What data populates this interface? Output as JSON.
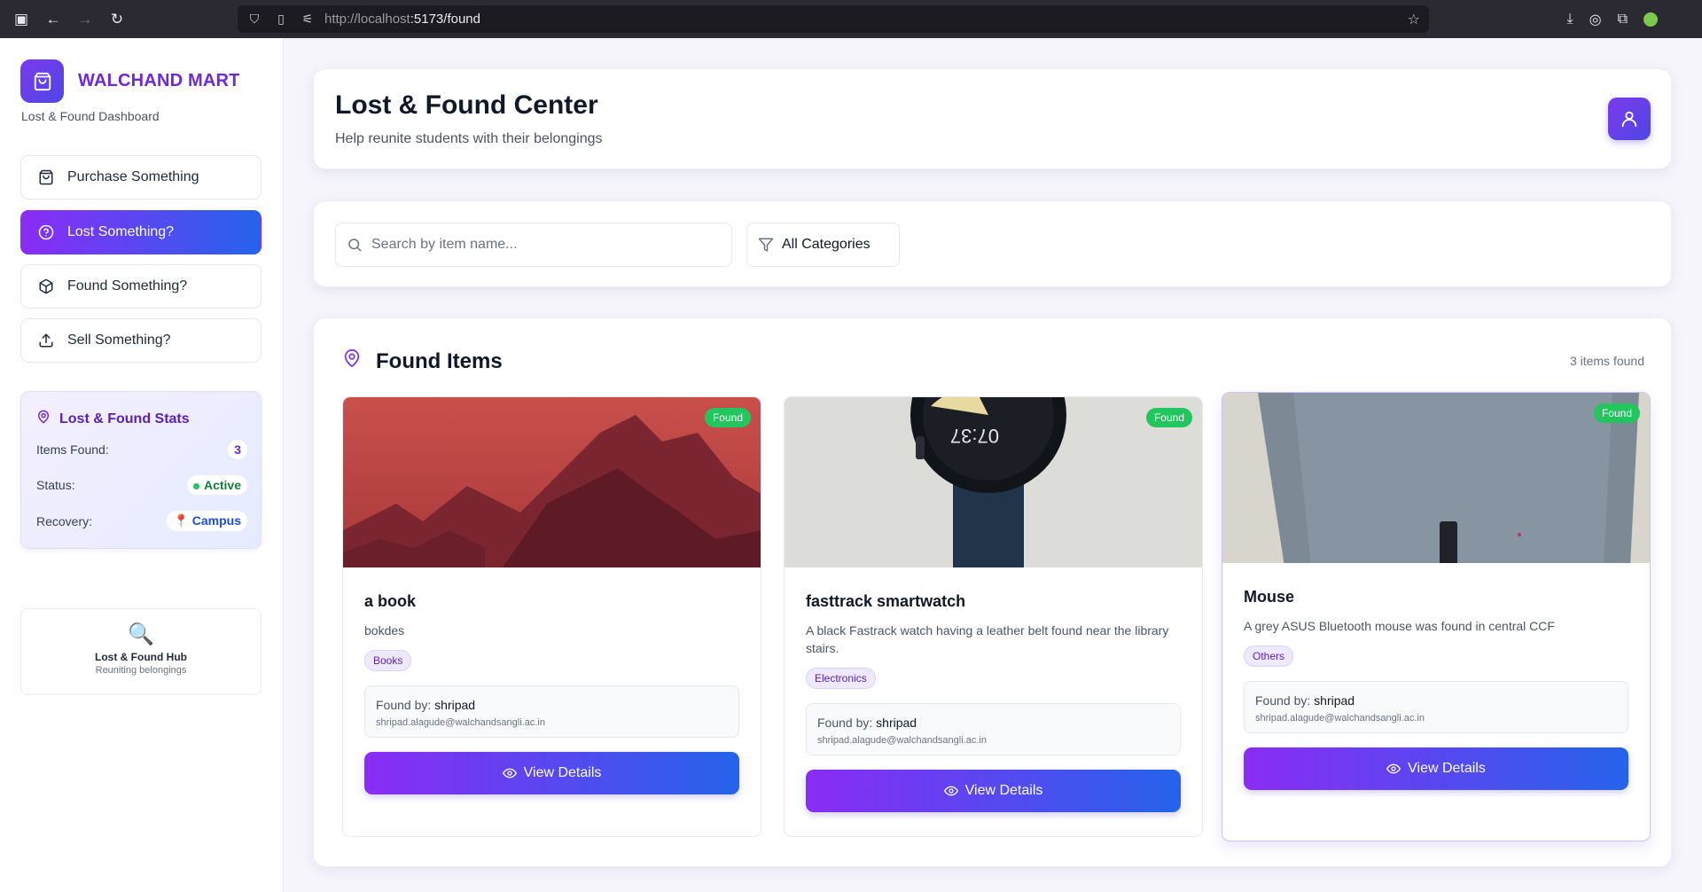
{
  "browser": {
    "url_host": "http://localhost",
    "url_path": ":5173/found"
  },
  "sidebar": {
    "brand_name": "WALCHAND MART",
    "brand_sub": "Lost & Found Dashboard",
    "nav": [
      {
        "label": "Purchase Something",
        "icon": "bag-icon",
        "active": false
      },
      {
        "label": "Lost Something?",
        "icon": "help-circle-icon",
        "active": true
      },
      {
        "label": "Found Something?",
        "icon": "package-icon",
        "active": false
      },
      {
        "label": "Sell Something?",
        "icon": "upload-icon",
        "active": false
      }
    ],
    "stats": {
      "title": "Lost & Found Stats",
      "items_found_label": "Items Found:",
      "items_found_value": "3",
      "status_label": "Status:",
      "status_value": "Active",
      "recovery_label": "Recovery:",
      "recovery_value": "📍 Campus"
    },
    "hub": {
      "icon": "🔍",
      "title": "Lost & Found Hub",
      "subtitle": "Reuniting belongings"
    }
  },
  "header": {
    "title": "Lost & Found Center",
    "subtitle": "Help reunite students with their belongings"
  },
  "filters": {
    "search_placeholder": "Search by item name...",
    "category": "All Categories"
  },
  "items_section": {
    "title": "Found Items",
    "count_text": "3 items found",
    "found_by_label": "Found by: ",
    "view_label": "View Details",
    "items": [
      {
        "badge": "Found",
        "name": "a book",
        "description": "bokdes",
        "category": "Books",
        "finder": "shripad",
        "email": "shripad.alagude@walchandsangli.ac.in",
        "image": "book-photo"
      },
      {
        "badge": "Found",
        "name": "fasttrack smartwatch",
        "description": "A black Fastrack watch having a leather belt found near the library stairs.",
        "category": "Electronics",
        "finder": "shripad",
        "email": "shripad.alagude@walchandsangli.ac.in",
        "image": "watch-photo"
      },
      {
        "badge": "Found",
        "name": "Mouse",
        "description": "A grey ASUS Bluetooth mouse was found in central CCF",
        "category": "Others",
        "finder": "shripad",
        "email": "shripad.alagude@walchandsangli.ac.in",
        "image": "mouse-photo"
      }
    ]
  }
}
